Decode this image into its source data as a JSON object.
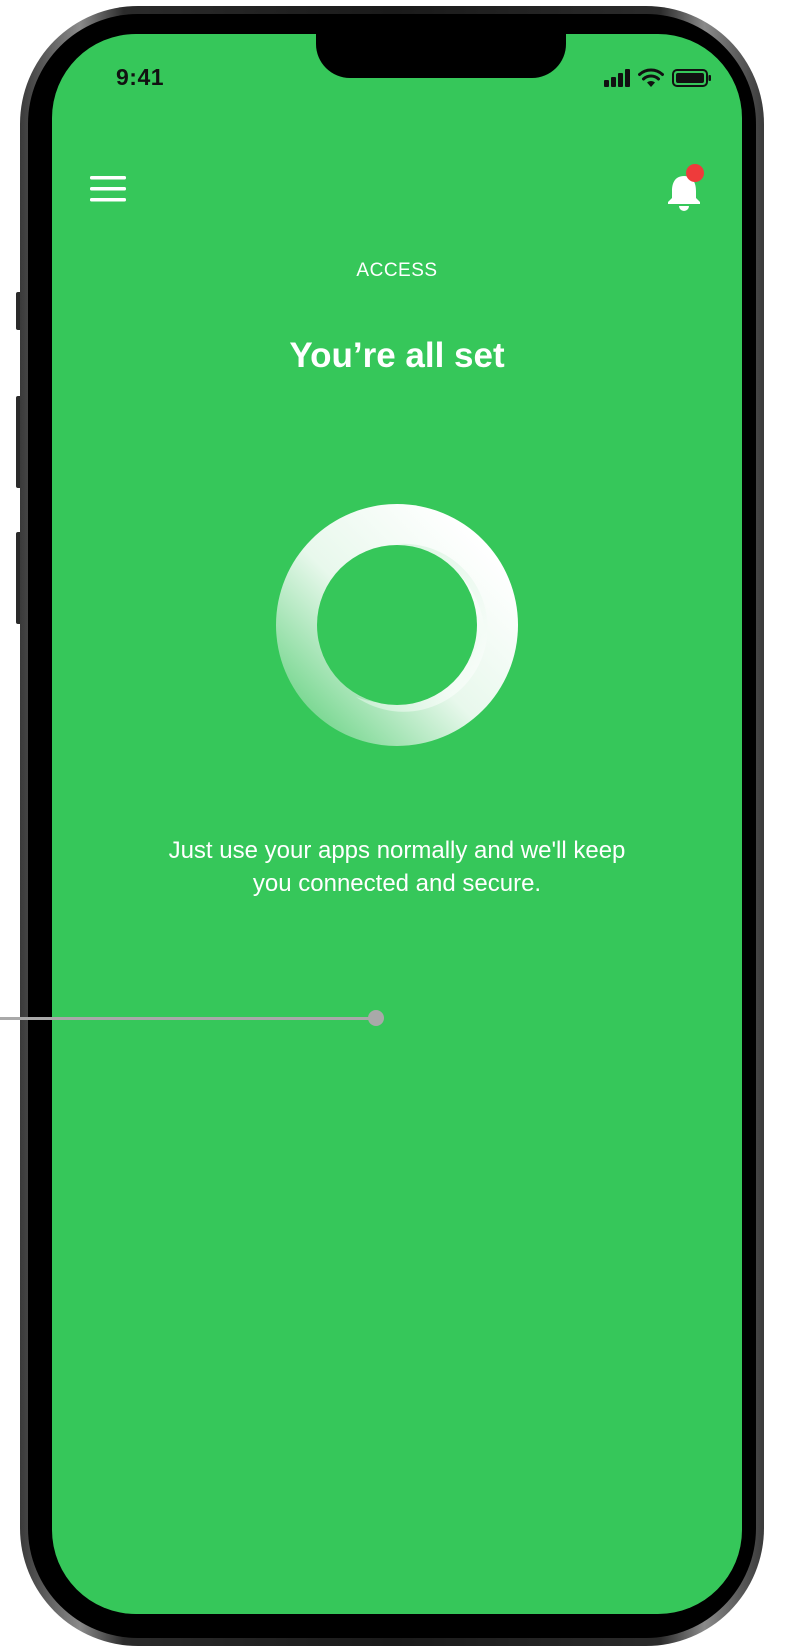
{
  "status_bar": {
    "time": "9:41"
  },
  "header": {
    "section_label": "ACCESS",
    "title": "You’re all set"
  },
  "main": {
    "message": "Just use your apps normally and we'll keep you connected and secure."
  },
  "icons": {
    "menu": "hamburger-menu-icon",
    "notifications": "bell-icon",
    "notification_badge_color": "#ee3b3b",
    "status_ring": "ring-icon"
  },
  "colors": {
    "background": "#36c75a",
    "text": "#ffffff",
    "annotation": "#a9a9a9"
  }
}
